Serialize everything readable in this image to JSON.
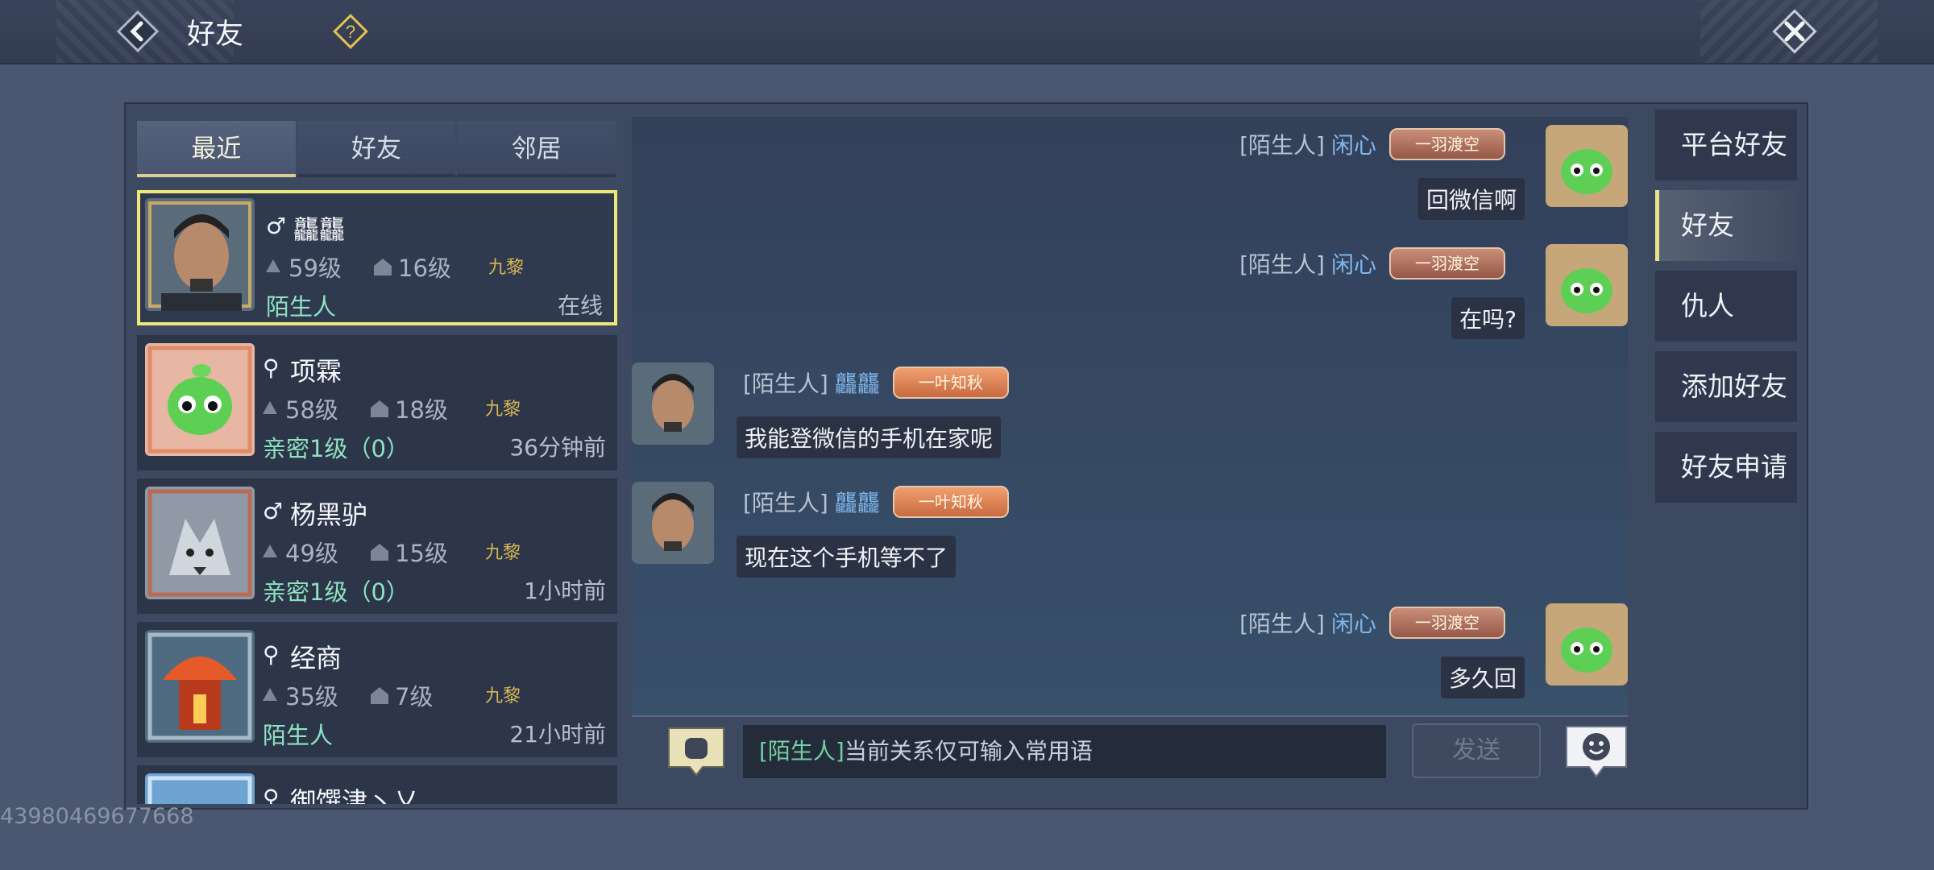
{
  "header": {
    "title": "好友",
    "icons": {
      "back": "back-arrow-icon",
      "help": "question-icon",
      "close": "close-x-icon"
    }
  },
  "list_tabs": [
    {
      "label": "最近",
      "active": true
    },
    {
      "label": "好友",
      "active": false
    },
    {
      "label": "邻居",
      "active": false
    }
  ],
  "friends": [
    {
      "gender": "♂",
      "name": "龘龘",
      "level": "59级",
      "fame": "16级",
      "server": "九黎",
      "relation": "陌生人",
      "status": "在线",
      "selected": true,
      "avatar": "male-warrior-avatar"
    },
    {
      "gender": "⚲",
      "name": "项霖",
      "level": "58级",
      "fame": "18级",
      "server": "九黎",
      "relation": "亲密1级（0）",
      "status": "36分钟前",
      "selected": false,
      "avatar": "green-sprite-avatar"
    },
    {
      "gender": "♂",
      "name": "杨黑驴",
      "level": "49级",
      "fame": "15级",
      "server": "九黎",
      "relation": "亲密1级（0）",
      "status": "1小时前",
      "selected": false,
      "avatar": "wolf-avatar"
    },
    {
      "gender": "⚲",
      "name": "经商",
      "level": "35级",
      "fame": "7级",
      "server": "九黎",
      "relation": "陌生人",
      "status": "21小时前",
      "selected": false,
      "avatar": "lantern-avatar"
    },
    {
      "gender": "⚲",
      "name": "御馔津丶乂",
      "level": "",
      "fame": "",
      "server": "",
      "relation": "",
      "status": "",
      "selected": false,
      "avatar": "blue-avatar"
    }
  ],
  "chat": {
    "messages": [
      {
        "side": "right",
        "tag": "[陌生人]",
        "sender": "闲心",
        "badge": "一羽渡空",
        "text": "回微信啊"
      },
      {
        "side": "right",
        "tag": "[陌生人]",
        "sender": "闲心",
        "badge": "一羽渡空",
        "text": "在吗?"
      },
      {
        "side": "left",
        "tag": "[陌生人]",
        "sender": "龘龘",
        "badge": "一叶知秋",
        "text": "我能登微信的手机在家呢"
      },
      {
        "side": "left",
        "tag": "[陌生人]",
        "sender": "龘龘",
        "badge": "一叶知秋",
        "text": "现在这个手机等不了"
      },
      {
        "side": "right",
        "tag": "[陌生人]",
        "sender": "闲心",
        "badge": "一羽渡空",
        "text": "多久回"
      }
    ],
    "input_tag": "[陌生人]",
    "input_text": "当前关系仅可输入常用语",
    "send_label": "发送",
    "quick_phrase_icon": "hand-bubble-icon",
    "emoji_icon": "smiley-bubble-icon"
  },
  "categories": [
    {
      "label": "平台好友",
      "active": false
    },
    {
      "label": "好友",
      "active": true
    },
    {
      "label": "仇人",
      "active": false
    },
    {
      "label": "添加好友",
      "active": false
    },
    {
      "label": "好友申请",
      "active": false
    }
  ],
  "watermark": "43980469677668"
}
